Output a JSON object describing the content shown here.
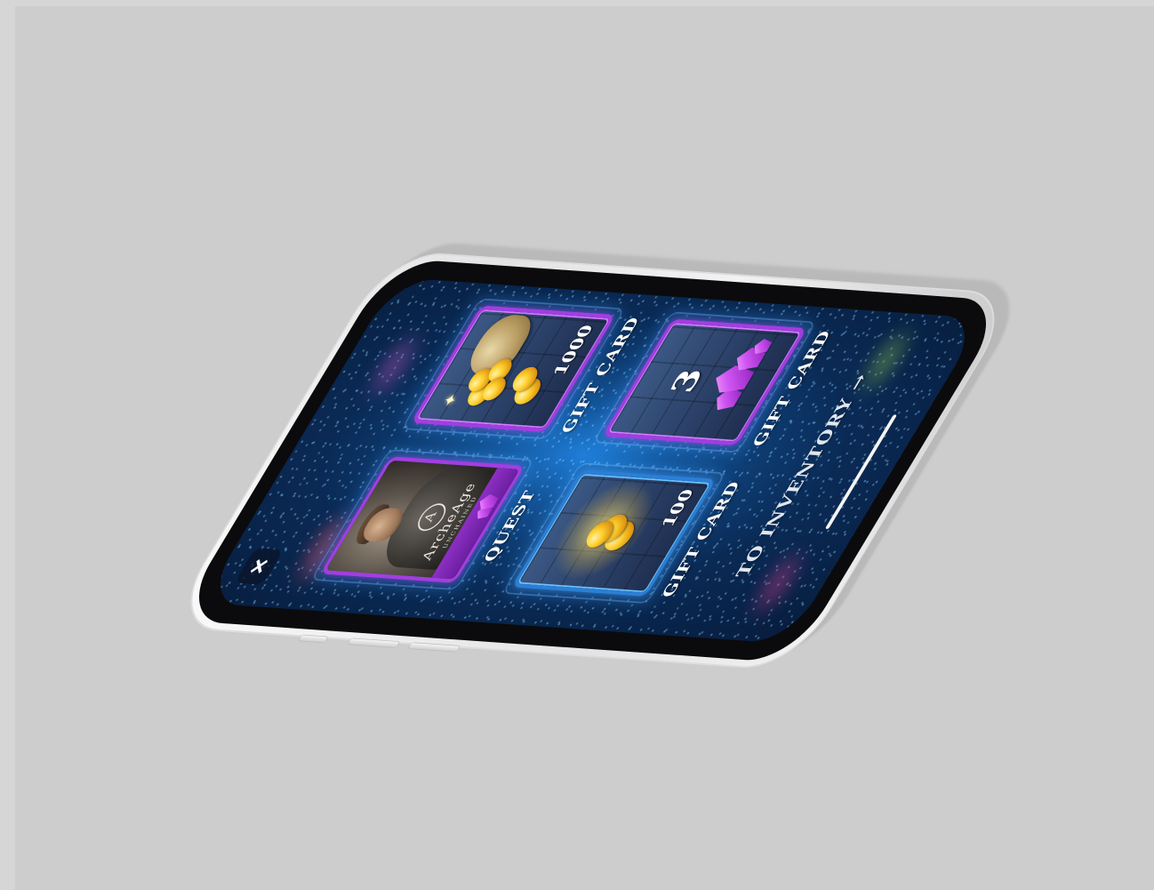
{
  "screen": {
    "close_button_glyph": "+",
    "cards": [
      {
        "type": "quest",
        "label": "QUEST",
        "art_title": "ArcheAge",
        "art_subtitle": "UNCHAINED"
      },
      {
        "type": "gift-card",
        "label": "GIFT CARD",
        "reward": "coins-sack",
        "amount": "1000"
      },
      {
        "type": "gift-card",
        "label": "GIFT CARD",
        "reward": "crystals",
        "amount": "3"
      },
      {
        "type": "gift-card",
        "label": "GIFT CARD",
        "reward": "coins",
        "amount": "100"
      }
    ],
    "inventory_link": "TO INVENTORY →"
  },
  "colors": {
    "background": "#cdcdcd",
    "screen_blue": "#14589f",
    "card_purple": "#a23ee0",
    "card_blue": "#2b7fd4",
    "gold": "#ffcf2e"
  }
}
